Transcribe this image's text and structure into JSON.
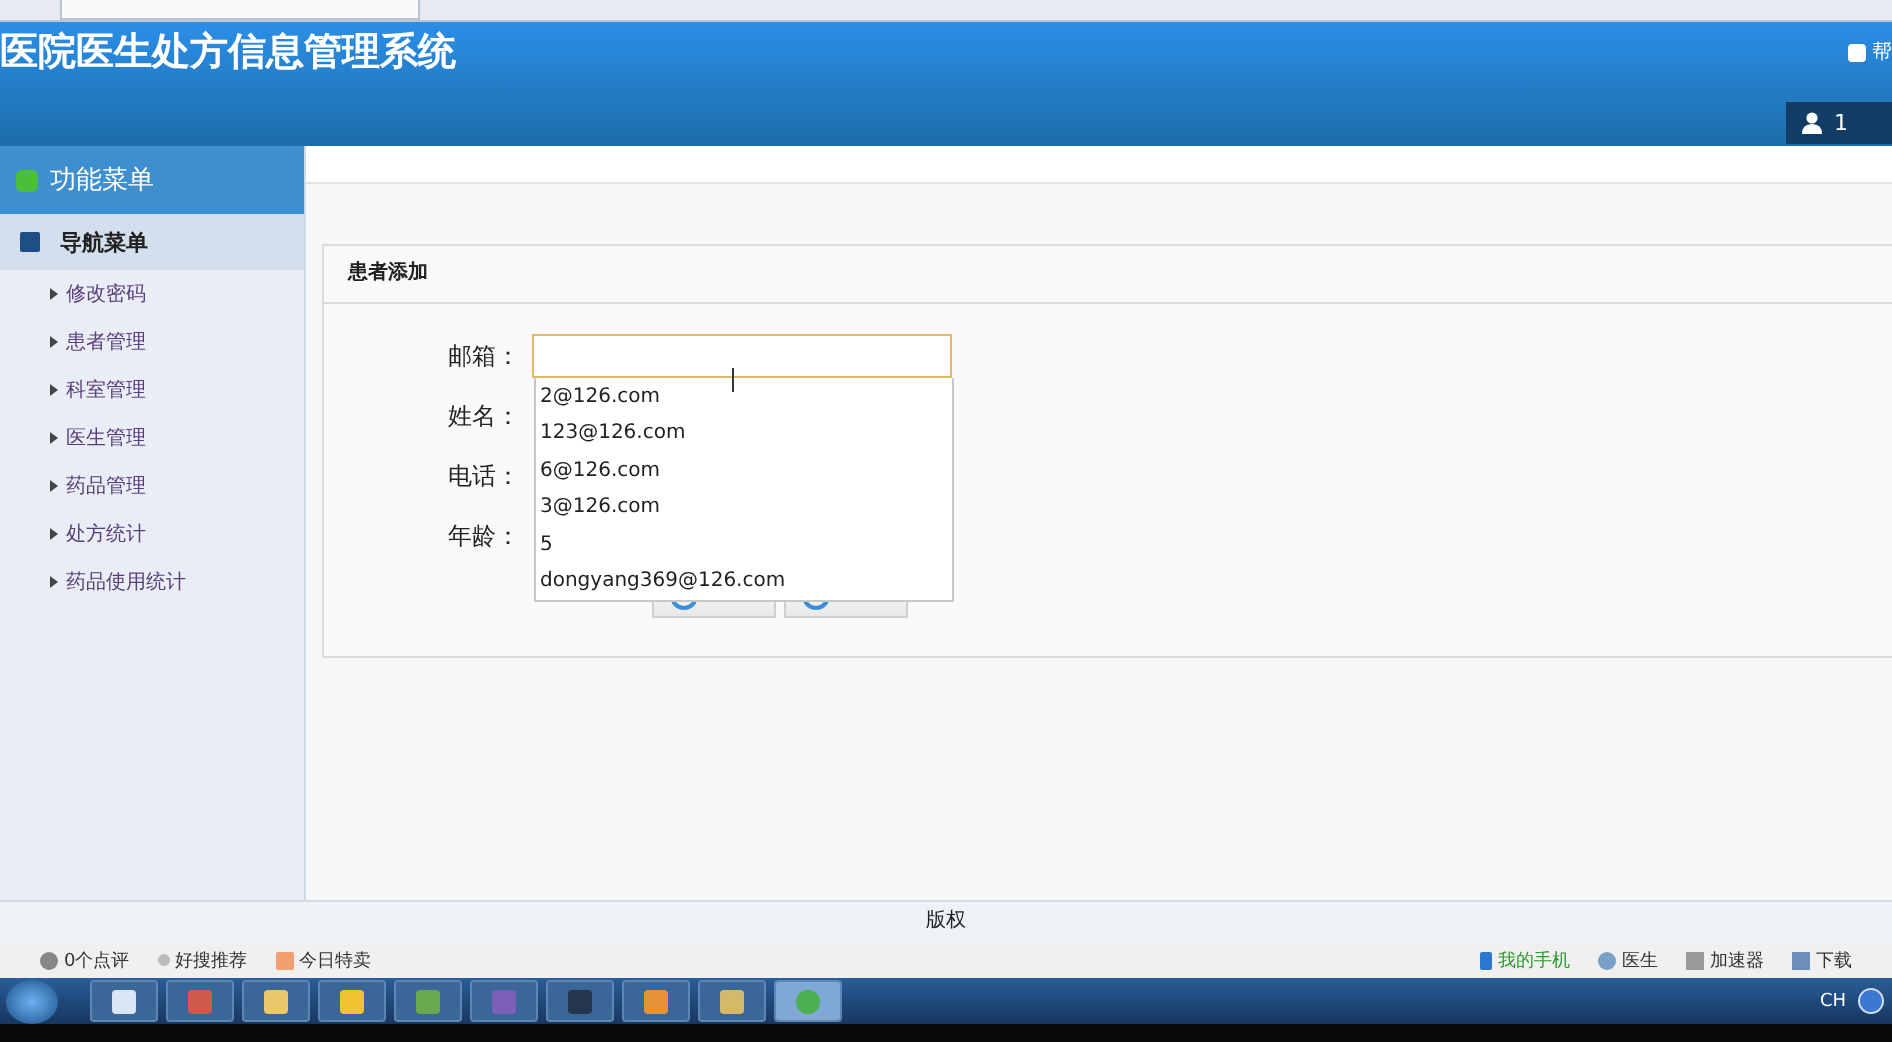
{
  "header": {
    "title": "医院医生处方信息管理系统",
    "help": "帮",
    "user": "1"
  },
  "sidebar": {
    "title": "功能菜单",
    "section": {
      "label": "导航菜单",
      "expanded": true,
      "items": [
        "修改密码",
        "患者管理",
        "科室管理",
        "医生管理",
        "药品管理",
        "处方统计",
        "药品使用统计"
      ]
    }
  },
  "panel": {
    "title": "患者添加",
    "fields": [
      {
        "label": "邮箱：",
        "kind": "input"
      },
      {
        "label": "姓名：",
        "kind": "hidden"
      },
      {
        "label": "电话：",
        "kind": "hidden"
      },
      {
        "label": "年龄：",
        "kind": "hidden"
      }
    ],
    "suggestions": [
      "2@126.com",
      "123@126.com",
      "6@126.com",
      "3@126.com",
      "5",
      "dongyang369@126.com"
    ]
  },
  "footer": {
    "copyright": "版权"
  },
  "browser_status": {
    "left": [
      "0个点评",
      "好搜推荐",
      "今日特卖"
    ],
    "right": [
      "我的手机",
      "医生",
      "加速器",
      "下载"
    ]
  },
  "taskbar": {
    "lang": "CH"
  }
}
